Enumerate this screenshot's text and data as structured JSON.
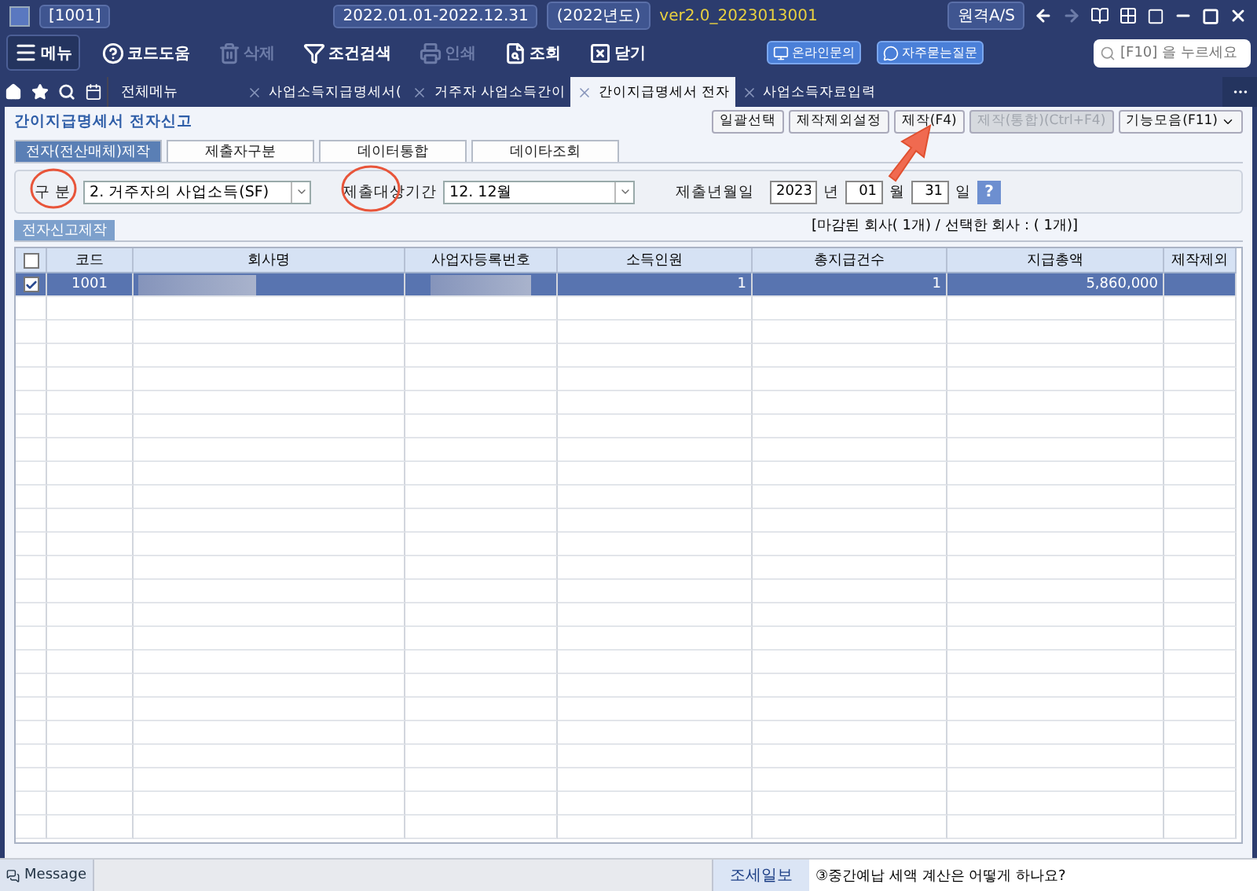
{
  "window": {
    "company_code": "[1001]",
    "period": "2022.01.01-2022.12.31",
    "fiscal_year": "(2022년도)",
    "version": "ver2.0_2023013001",
    "remote_button": "원격A/S"
  },
  "toolbar": [
    {
      "kind": "menu",
      "label": "메뉴",
      "disabled": false
    },
    {
      "kind": "help",
      "label": "코드도움",
      "disabled": false
    },
    {
      "kind": "delete",
      "label": "삭제",
      "disabled": true
    },
    {
      "kind": "filter",
      "label": "조건검색",
      "disabled": false
    },
    {
      "kind": "print",
      "label": "인쇄",
      "disabled": true
    },
    {
      "kind": "lookup",
      "label": "조회",
      "disabled": false
    },
    {
      "kind": "close",
      "label": "닫기",
      "disabled": false
    }
  ],
  "support_buttons": [
    {
      "kind": "online",
      "label": "온라인문의"
    },
    {
      "kind": "faq",
      "label": "자주묻는질문"
    }
  ],
  "search": {
    "placeholder": "[F10] 을 누르세요"
  },
  "menu_tab": "전체메뉴",
  "tabs": [
    {
      "label": "사업소득지급명세서(",
      "selected": false
    },
    {
      "label": "거주자 사업소득간이",
      "selected": false
    },
    {
      "label": "간이지급명세서 전자",
      "selected": true
    },
    {
      "label": "사업소득자료입력",
      "selected": false
    }
  ],
  "page_title": "간이지급명세서 전자신고",
  "actions": [
    {
      "label": "일괄선택",
      "disabled": false,
      "dropdown": false
    },
    {
      "label": "제작제외설정",
      "disabled": false,
      "dropdown": false
    },
    {
      "label": "제작(F4)",
      "disabled": false,
      "dropdown": false
    },
    {
      "label": "제작(통합)(Ctrl+F4)",
      "disabled": true,
      "dropdown": false
    },
    {
      "label": "기능모음(F11)",
      "disabled": false,
      "dropdown": true
    }
  ],
  "sub_tabs": [
    {
      "label": "전자(전산매체)제작",
      "selected": true
    },
    {
      "label": "제출자구분",
      "selected": false
    },
    {
      "label": "데이터통합",
      "selected": false
    },
    {
      "label": "데이타조회",
      "selected": false
    }
  ],
  "form": {
    "type_label": "구 분",
    "type_value": "2. 거주자의 사업소득(SF)",
    "period_label": "제출대상기간",
    "period_value": "12. 12월",
    "date_label": "제출년월일",
    "year": "2023",
    "year_unit": "년",
    "month": "01",
    "month_unit": "월",
    "day": "31",
    "day_unit": "일",
    "help": "?"
  },
  "section_button": "전자신고제작",
  "summary": "[마감된 회사( 1개) / 선택한 회사 : ( 1개)]",
  "table": {
    "columns": [
      "코드",
      "회사명",
      "사업자등록번호",
      "소득인원",
      "총지급건수",
      "지급총액",
      "제작제외"
    ],
    "header_checked": false,
    "rows": [
      {
        "checked": true,
        "selected": true,
        "cells": [
          "1001",
          "",
          "",
          "1",
          "1",
          "5,860,000",
          ""
        ]
      }
    ]
  },
  "status_bar": {
    "message": "Message",
    "news_label": "조세일보",
    "news": "③중간예납 세액 계산은 어떻게 하나요?"
  }
}
